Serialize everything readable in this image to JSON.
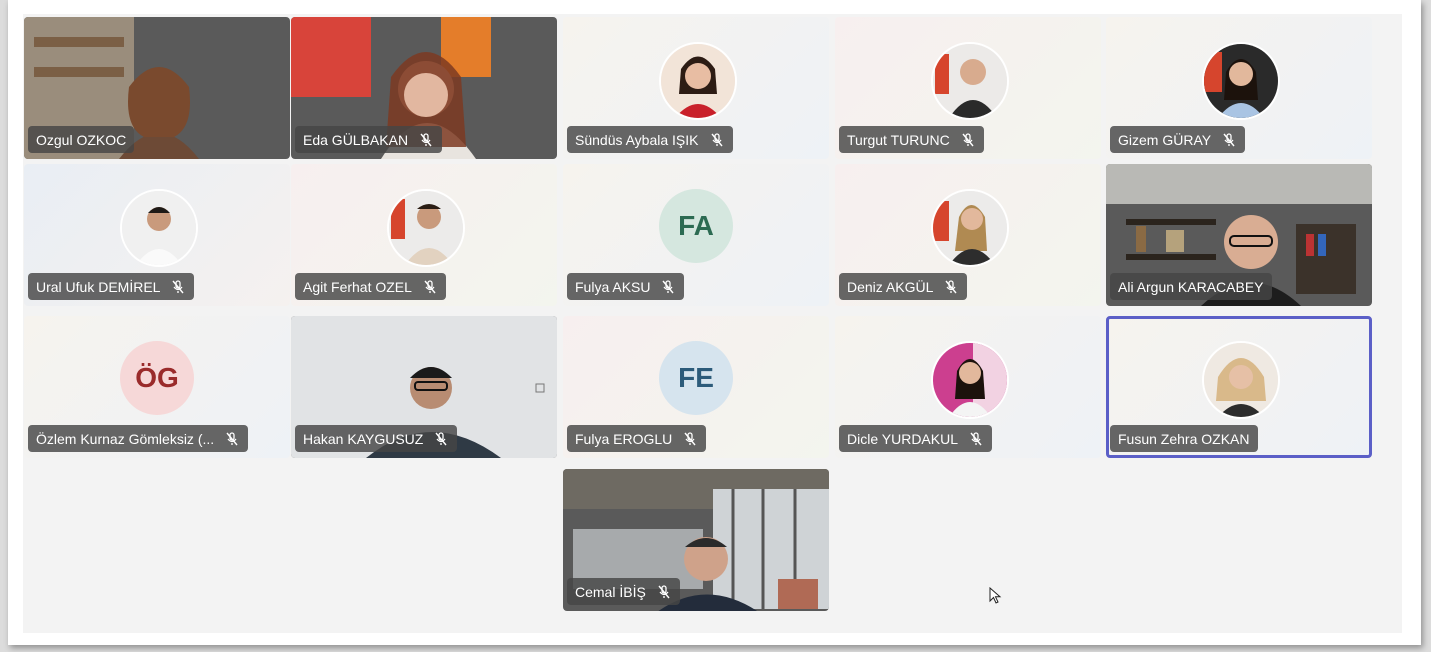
{
  "participants": [
    {
      "name": "Ozgul OZKOC",
      "muted": false,
      "kind": "video"
    },
    {
      "name": "Eda GÜLBAKAN",
      "muted": true,
      "kind": "video"
    },
    {
      "name": "Sündüs Aybala IŞIK",
      "muted": true,
      "kind": "photo"
    },
    {
      "name": "Turgut TURUNC",
      "muted": true,
      "kind": "photo"
    },
    {
      "name": "Gizem GÜRAY",
      "muted": true,
      "kind": "photo"
    },
    {
      "name": "Ural Ufuk DEMİREL",
      "muted": true,
      "kind": "photo"
    },
    {
      "name": "Agit Ferhat OZEL",
      "muted": true,
      "kind": "photo"
    },
    {
      "name": "Fulya AKSU",
      "muted": true,
      "kind": "initials",
      "initials": "FA",
      "color": "#2c6b52",
      "bg": "#d5e7df"
    },
    {
      "name": "Deniz AKGÜL",
      "muted": true,
      "kind": "photo"
    },
    {
      "name": "Ali Argun KARACABEY",
      "muted": false,
      "kind": "video"
    },
    {
      "name": "Özlem Kurnaz Gömleksiz (...",
      "muted": true,
      "kind": "initials",
      "initials": "ÖG",
      "color": "#9a2b2b",
      "bg": "#f6d8d8"
    },
    {
      "name": "Hakan KAYGUSUZ",
      "muted": true,
      "kind": "video"
    },
    {
      "name": "Fulya EROGLU",
      "muted": true,
      "kind": "initials",
      "initials": "FE",
      "color": "#2c5b7a",
      "bg": "#d6e4ee"
    },
    {
      "name": "Dicle YURDAKUL",
      "muted": true,
      "kind": "photo"
    },
    {
      "name": "Fusun Zehra OZKAN",
      "muted": false,
      "kind": "photo",
      "active": true
    },
    {
      "name": "Cemal İBİŞ",
      "muted": true,
      "kind": "video"
    }
  ],
  "colors": {
    "active_outline": "#5b5fc7",
    "nametag_bg": "#464646"
  }
}
